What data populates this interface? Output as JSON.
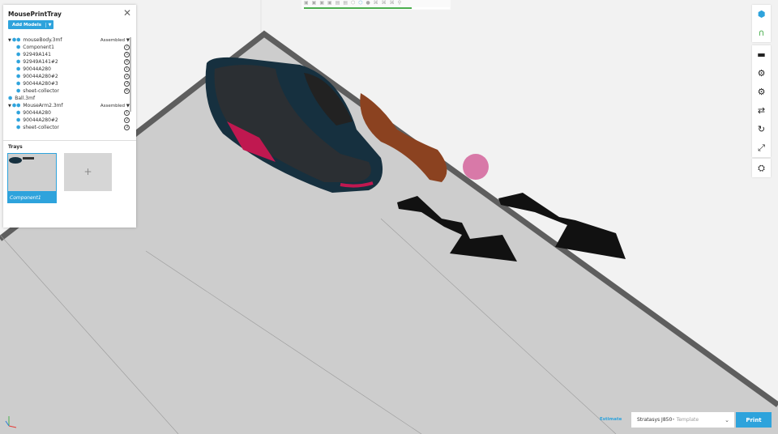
{
  "panel": {
    "title": "MousePrintTray",
    "add_models": "Add Models",
    "trays_label": "Trays",
    "tree": [
      {
        "label": "mouseBody.3mf",
        "level": 0,
        "expand": true,
        "status": "Assembled"
      },
      {
        "label": "Component1",
        "level": 1,
        "badge": "7"
      },
      {
        "label": "92949A141",
        "level": 1,
        "badge": "5"
      },
      {
        "label": "92949A141#2",
        "level": 1,
        "badge": "4"
      },
      {
        "label": "90044A280",
        "level": 1,
        "badge": "1"
      },
      {
        "label": "90044A280#2",
        "level": 1,
        "badge": "2"
      },
      {
        "label": "90044A280#3",
        "level": 1,
        "badge": "3"
      },
      {
        "label": "sheet-collector",
        "level": 1,
        "badge": "6"
      },
      {
        "label": "Ball.3mf",
        "level": 0
      },
      {
        "label": "MouseArm2.3mf",
        "level": 0,
        "expand": true,
        "status": "Assembled"
      },
      {
        "label": "90044A280",
        "level": 1,
        "badge": "1"
      },
      {
        "label": "90044A280#2",
        "level": 1,
        "badge": "2"
      },
      {
        "label": "sheet-collector",
        "level": 1,
        "badge": "3"
      }
    ],
    "trays": [
      {
        "label": "Component1",
        "selected": true
      }
    ],
    "add_tray": "+"
  },
  "toolbar": {
    "progress": 0.74
  },
  "bottom": {
    "estimate": "Estimate",
    "printer": "Stratasys J850",
    "template": " • Template",
    "print": "Print"
  },
  "colors": {
    "accent": "#2ea3dc",
    "progress": "#4caf50"
  }
}
